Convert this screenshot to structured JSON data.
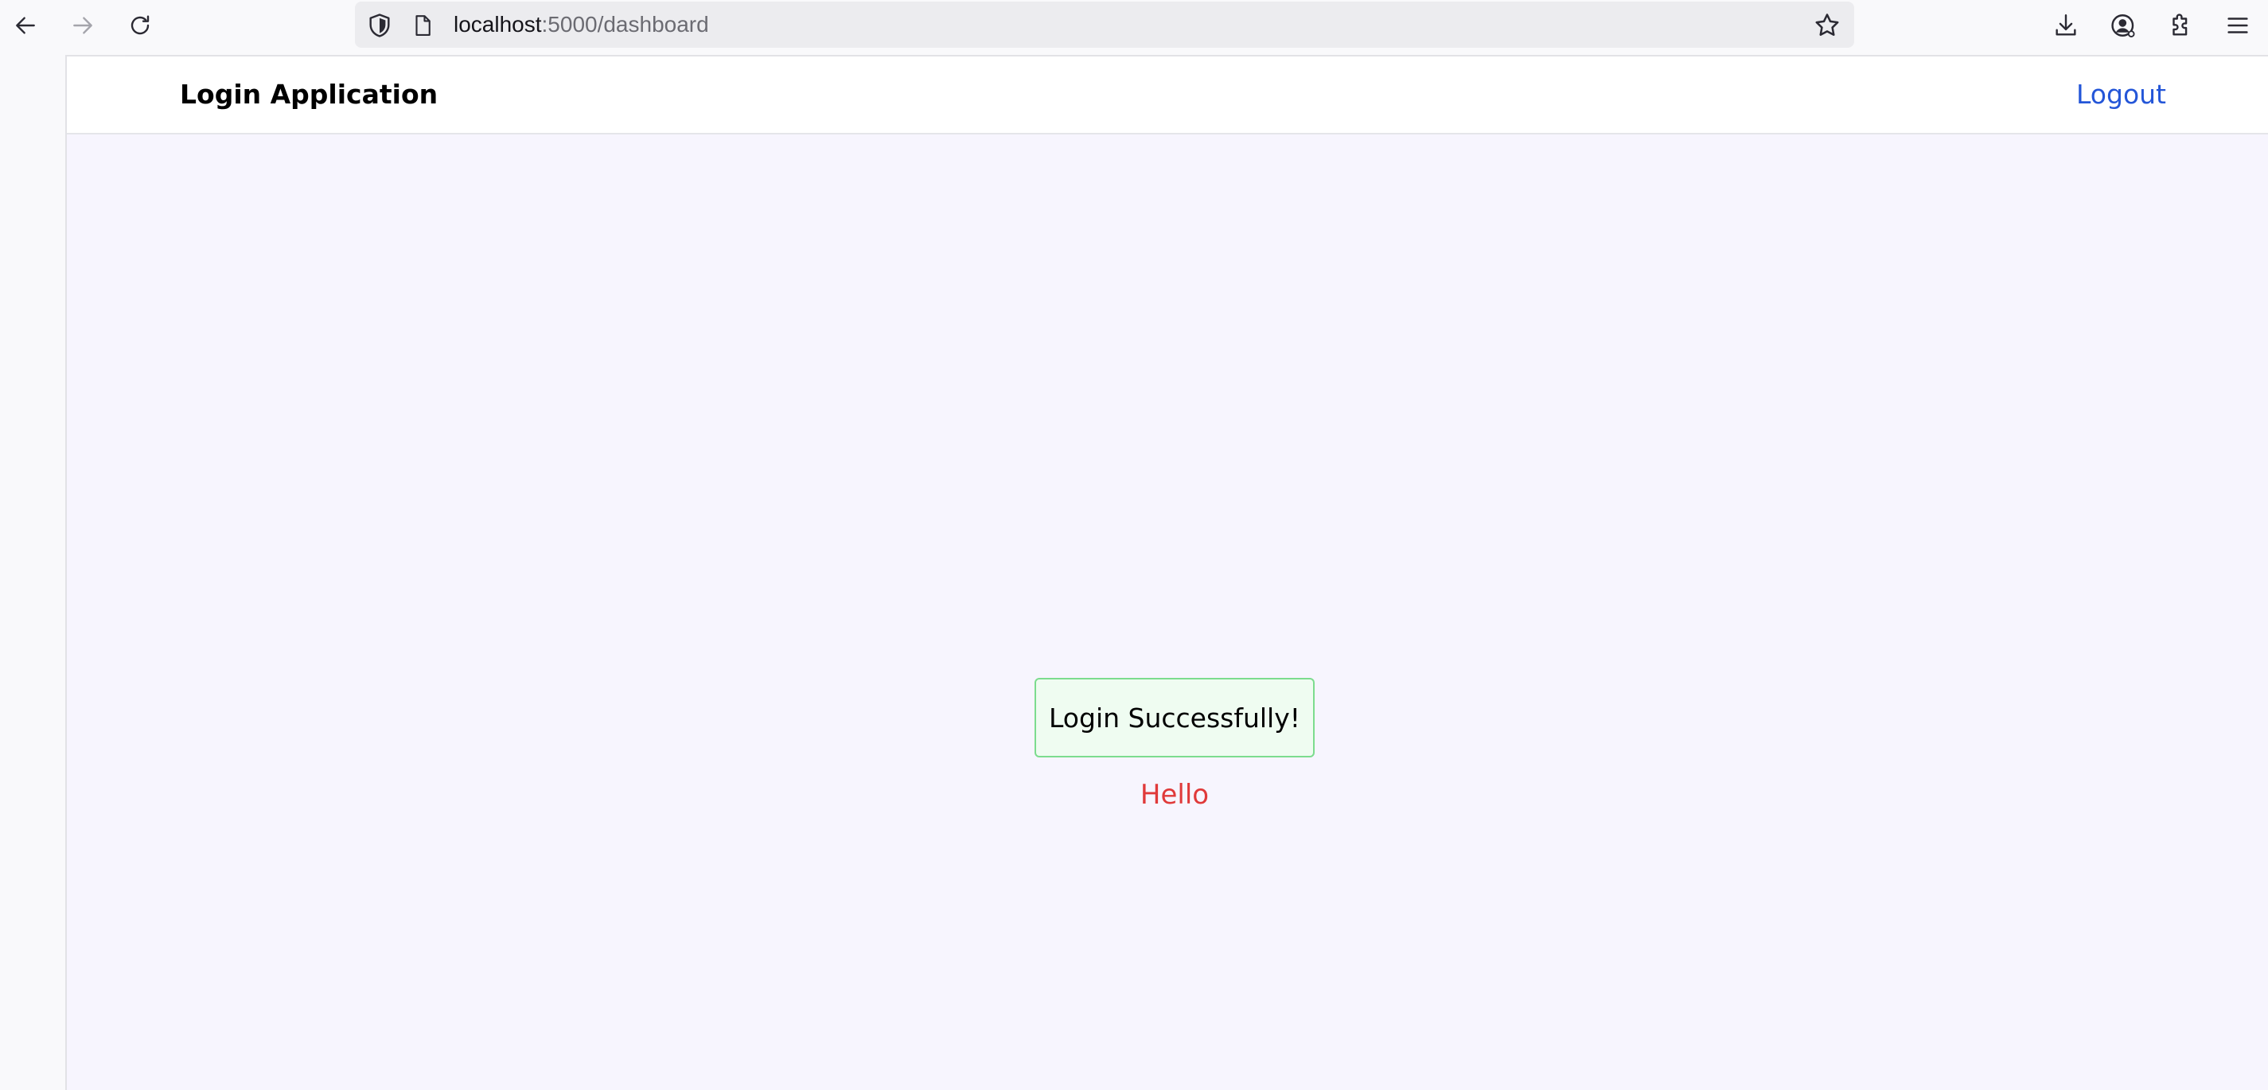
{
  "browser": {
    "url_host": "localhost",
    "url_path": ":5000/dashboard",
    "icons": {
      "back": "arrow-left-icon",
      "forward": "arrow-right-icon",
      "reload": "reload-icon",
      "shield": "shield-icon",
      "page": "page-icon",
      "bookmark": "star-icon",
      "downloads": "download-icon",
      "account": "account-icon",
      "extensions": "puzzle-icon",
      "menu": "hamburger-menu-icon"
    }
  },
  "navbar": {
    "brand": "Login Application",
    "logout_label": "Logout"
  },
  "main": {
    "alert_message": "Login Successfully!",
    "greeting": "Hello"
  },
  "colors": {
    "page_background": "#f7f5fe",
    "link": "#2456d8",
    "greeting": "#e03a3a",
    "alert_background": "#effcf1",
    "alert_border": "#7cdc8e"
  }
}
